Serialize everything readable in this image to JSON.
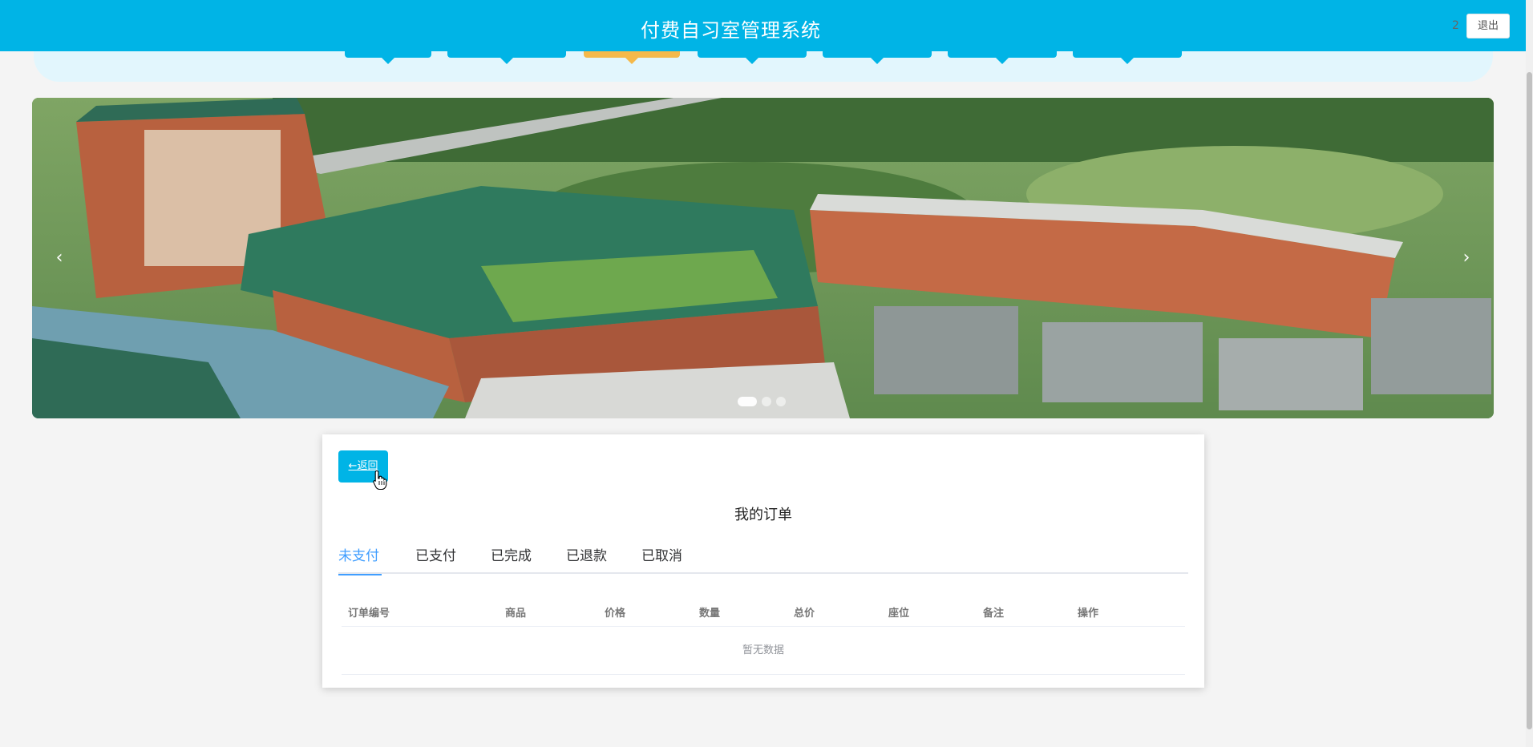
{
  "header": {
    "title": "付费自习室管理系统",
    "user_name": "2",
    "logout_label": "退出",
    "accent_color": "#00b4e6"
  },
  "nav": {
    "active_index": 2,
    "active_color": "#f5b94a"
  },
  "carousel": {
    "prev_icon": "‹",
    "next_icon": "›",
    "slide_count": 3,
    "active_slide": 0
  },
  "orders": {
    "back_label": "←返回",
    "title": "我的订单",
    "tabs": [
      {
        "label": "未支付",
        "active": true
      },
      {
        "label": "已支付",
        "active": false
      },
      {
        "label": "已完成",
        "active": false
      },
      {
        "label": "已退款",
        "active": false
      },
      {
        "label": "已取消",
        "active": false
      }
    ],
    "columns": [
      "订单编号",
      "商品",
      "价格",
      "数量",
      "总价",
      "座位",
      "备注",
      "操作"
    ],
    "empty_text": "暂无数据",
    "active_tab_color": "#409eff"
  }
}
